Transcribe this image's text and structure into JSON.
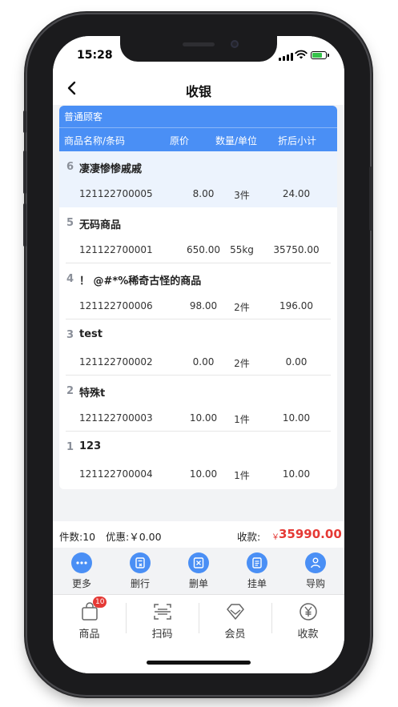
{
  "status_bar": {
    "time": "15:28"
  },
  "nav": {
    "title": "收银"
  },
  "order": {
    "customer": "普通顾客",
    "columns": {
      "name_code": "商品名称/条码",
      "price": "原价",
      "qty_unit": "数量/单位",
      "subtotal": "折后小计"
    },
    "items": [
      {
        "index": "6",
        "name": "凄凄惨惨戚戚",
        "code": "121122700005",
        "price": "8.00",
        "qty": "3件",
        "subtotal": "24.00",
        "selected": true
      },
      {
        "index": "5",
        "name": "无码商品",
        "code": "121122700001",
        "price": "650.00",
        "qty": "55kg",
        "subtotal": "35750.00"
      },
      {
        "index": "4",
        "name": "！ @#*%稀奇古怪的商品",
        "code": "121122700006",
        "price": "98.00",
        "qty": "2件",
        "subtotal": "196.00"
      },
      {
        "index": "3",
        "name": "test",
        "code": "121122700002",
        "price": "0.00",
        "qty": "2件",
        "subtotal": "0.00"
      },
      {
        "index": "2",
        "name": "特殊t",
        "code": "121122700003",
        "price": "10.00",
        "qty": "1件",
        "subtotal": "10.00"
      },
      {
        "index": "1",
        "name": "123",
        "code": "121122700004",
        "price": "10.00",
        "qty": "1件",
        "subtotal": "10.00"
      }
    ]
  },
  "summary": {
    "count": "件数:10",
    "discount": "优惠:￥0.00",
    "pay_label": "收款:",
    "currency": "￥",
    "total": "35990.00"
  },
  "actions": [
    {
      "label": "更多",
      "icon": "more-icon"
    },
    {
      "label": "删行",
      "icon": "delete-row-icon"
    },
    {
      "label": "删单",
      "icon": "delete-order-icon"
    },
    {
      "label": "挂单",
      "icon": "hold-order-icon"
    },
    {
      "label": "导购",
      "icon": "shopping-guide-icon"
    }
  ],
  "tabs": [
    {
      "label": "商品",
      "icon": "shopping-bag-icon",
      "badge": "10"
    },
    {
      "label": "扫码",
      "icon": "scan-icon"
    },
    {
      "label": "会员",
      "icon": "member-diamond-icon"
    },
    {
      "label": "收款",
      "icon": "yuan-coin-icon"
    }
  ],
  "colors": {
    "accent": "#4a8ff5",
    "total_red": "#e53935",
    "selected_row": "#ecf3fd"
  }
}
